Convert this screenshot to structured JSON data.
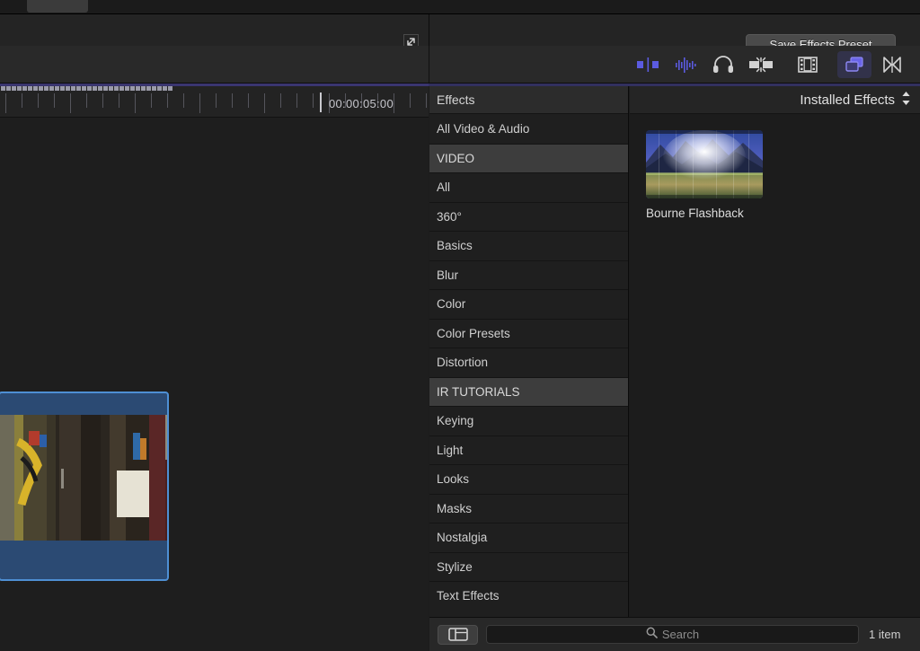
{
  "inspector_bar": {
    "expand_icon": "expand-diagonal-icon",
    "save_preset_label": "Save Effects Preset"
  },
  "toolbar": {
    "icons": [
      {
        "name": "audio-enhancements-icon",
        "active": true
      },
      {
        "name": "audio-meters-icon",
        "active": true
      },
      {
        "name": "headphones-icon",
        "active": false
      },
      {
        "name": "retime-icon",
        "active": false
      },
      {
        "name": "film-strip-icon",
        "active": false
      },
      {
        "name": "effects-browser-icon",
        "active": true
      },
      {
        "name": "transitions-browser-icon",
        "active": false
      }
    ]
  },
  "timeline": {
    "timecode": "00:00:05:00",
    "clip": {
      "name": "selected-clip",
      "selection_color": "#4e8fd4",
      "fill_color": "#2b4a73"
    }
  },
  "effects_sidebar": {
    "title": "Effects",
    "items": [
      {
        "label": "All Video & Audio",
        "type": "item"
      },
      {
        "label": "VIDEO",
        "type": "header"
      },
      {
        "label": "All",
        "type": "item"
      },
      {
        "label": "360°",
        "type": "item"
      },
      {
        "label": "Basics",
        "type": "item"
      },
      {
        "label": "Blur",
        "type": "item"
      },
      {
        "label": "Color",
        "type": "item"
      },
      {
        "label": "Color Presets",
        "type": "item"
      },
      {
        "label": "Distortion",
        "type": "item"
      },
      {
        "label": "IR TUTORIALS",
        "type": "header"
      },
      {
        "label": "Keying",
        "type": "item"
      },
      {
        "label": "Light",
        "type": "item"
      },
      {
        "label": "Looks",
        "type": "item"
      },
      {
        "label": "Masks",
        "type": "item"
      },
      {
        "label": "Nostalgia",
        "type": "item"
      },
      {
        "label": "Stylize",
        "type": "item"
      },
      {
        "label": "Text Effects",
        "type": "item"
      }
    ]
  },
  "installed_effects": {
    "title": "Installed Effects",
    "sort_icon": "chevron-up-down-icon",
    "items": [
      {
        "label": "Bourne Flashback",
        "thumbnail": "landscape-sun-flare-thumbnail"
      }
    ]
  },
  "bottom_bar": {
    "sidebar_toggle_icon": "sidebar-toggle-icon",
    "search_icon": "search-icon",
    "search_placeholder": "Search",
    "search_value": "",
    "item_count": "1 item"
  }
}
